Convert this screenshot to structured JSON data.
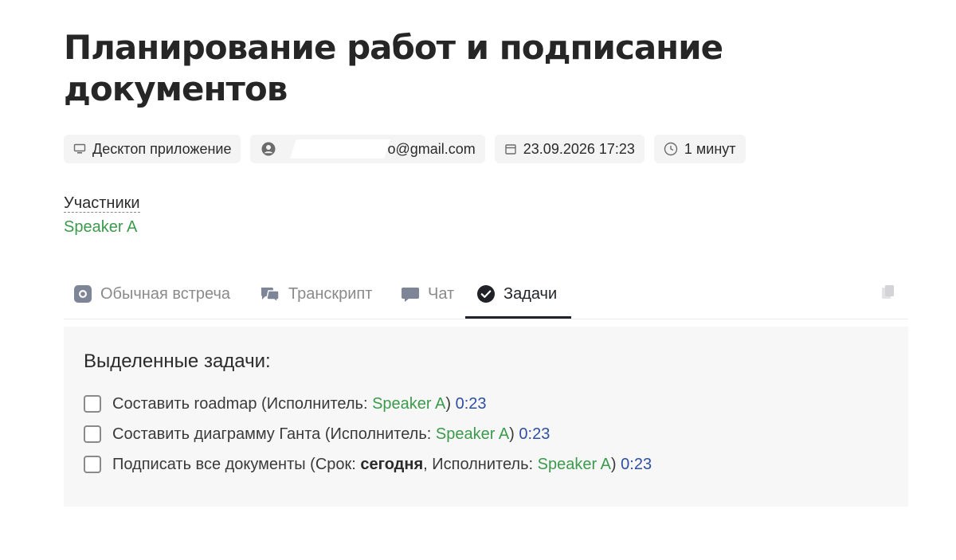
{
  "page": {
    "title": "Планирование работ и подписание документов"
  },
  "meta_chips": {
    "source": "Десктоп приложение",
    "email_partial": "o@gmail.com",
    "datetime": "23.09.2026 17:23",
    "duration": "1 минут"
  },
  "participants": {
    "label": "Участники",
    "items": [
      "Speaker A"
    ]
  },
  "tabs": [
    {
      "label": "Обычная встреча",
      "icon": "meeting-icon",
      "active": false
    },
    {
      "label": "Транскрипт",
      "icon": "transcript-icon",
      "active": false
    },
    {
      "label": "Чат",
      "icon": "chat-icon",
      "active": false
    },
    {
      "label": "Задачи",
      "icon": "check-circle-icon",
      "active": true
    }
  ],
  "tasks": {
    "heading": "Выделенные задачи:",
    "items": [
      {
        "pre": "Составить roadmap (Исполнитель: ",
        "assignee": "Speaker A",
        "post": ")",
        "time": "0:23",
        "checked": false
      },
      {
        "pre": "Составить диаграмму Ганта (Исполнитель: ",
        "assignee": "Speaker A",
        "post": ")",
        "time": "0:23",
        "checked": false
      },
      {
        "pre": "Подписать все документы (Срок: ",
        "deadline": "сегодня",
        "mid": ", Исполнитель: ",
        "assignee": "Speaker A",
        "post": ")",
        "time": "0:23",
        "checked": false
      }
    ]
  },
  "colors": {
    "accent_green": "#3b9a4b",
    "timestamp_blue": "#2d4fa3",
    "text_dark": "#262626",
    "panel_bg": "#f7f7f8"
  }
}
